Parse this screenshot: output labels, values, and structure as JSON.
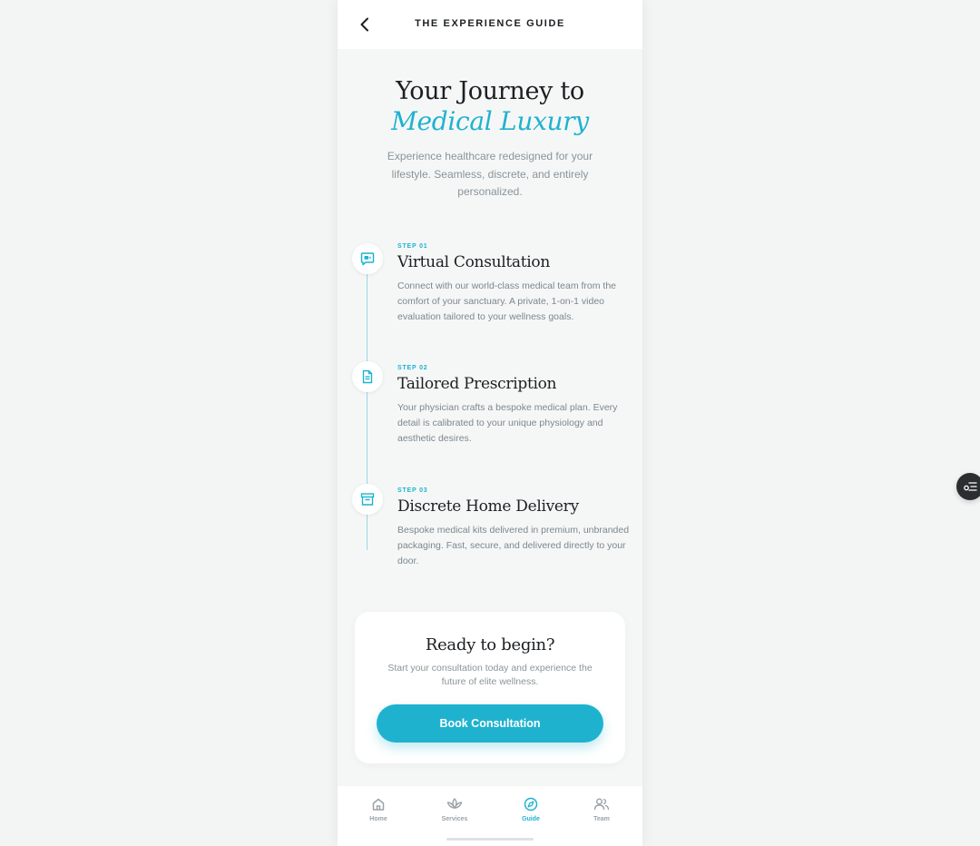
{
  "header": {
    "title": "THE EXPERIENCE GUIDE"
  },
  "hero": {
    "title": "Your Journey to",
    "accent": "Medical Luxury",
    "subtitle": "Experience healthcare redesigned for your lifestyle. Seamless, discrete, and entirely personalized."
  },
  "steps": [
    {
      "label": "STEP 01",
      "title": "Virtual Consultation",
      "description": "Connect with our world-class medical team from the comfort of your sanctuary. A private, 1-on-1 video evaluation tailored to your wellness goals.",
      "icon": "video-chat-icon"
    },
    {
      "label": "STEP 02",
      "title": "Tailored Prescription",
      "description": "Your physician crafts a bespoke medical plan. Every detail is calibrated to your unique physiology and aesthetic desires.",
      "icon": "document-icon"
    },
    {
      "label": "STEP 03",
      "title": "Discrete Home Delivery",
      "description": "Bespoke medical kits delivered in premium, unbranded packaging. Fast, secure, and delivered directly to your door.",
      "icon": "archive-box-icon"
    }
  ],
  "cta": {
    "title": "Ready to begin?",
    "subtitle": "Start your consultation today and experience the future of elite wellness.",
    "button_label": "Book Consultation"
  },
  "nav": {
    "items": [
      {
        "label": "Home",
        "icon": "home-icon",
        "active": false
      },
      {
        "label": "Services",
        "icon": "lotus-icon",
        "active": false
      },
      {
        "label": "Guide",
        "icon": "compass-icon",
        "active": true
      },
      {
        "label": "Team",
        "icon": "team-icon",
        "active": false
      }
    ]
  },
  "colors": {
    "accent": "#1fb2cf",
    "text_dark": "#1c1f22",
    "text_muted": "#8a9499",
    "background": "#f5f7f7"
  }
}
